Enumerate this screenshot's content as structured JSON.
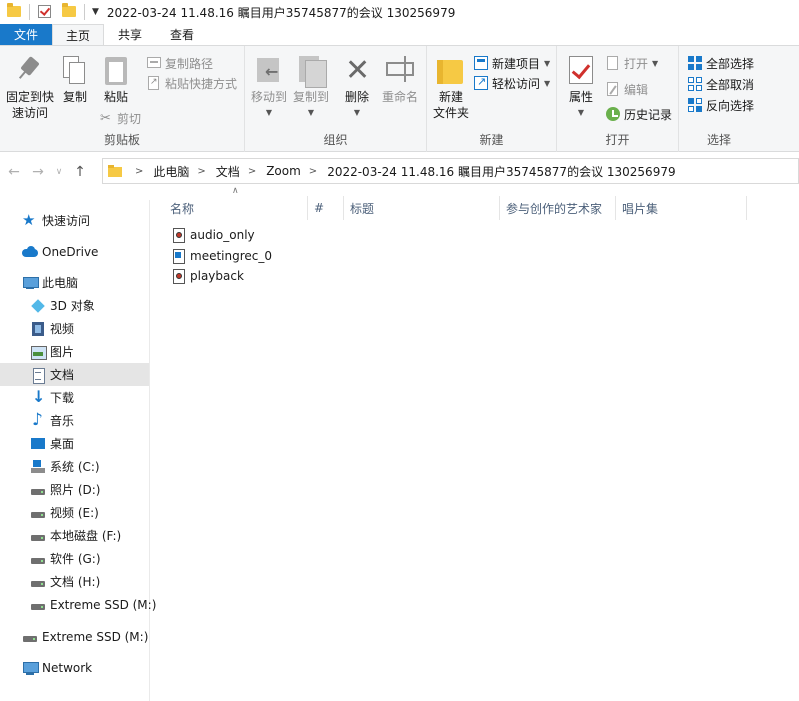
{
  "window": {
    "title": "2022-03-24 11.48.16 瞩目用户35745877的会议 130256979"
  },
  "tabs": [
    "文件",
    "主页",
    "共享",
    "查看"
  ],
  "ribbon": {
    "clipboard": {
      "pin_label": "固定到快\n速访问",
      "copy_label": "复制",
      "paste_label": "粘贴",
      "copy_path_label": "复制路径",
      "paste_shortcut_label": "粘贴快捷方式",
      "cut_label": "剪切",
      "group_label": "剪贴板"
    },
    "organize": {
      "move_to_label": "移动到",
      "copy_to_label": "复制到",
      "delete_label": "删除",
      "rename_label": "重命名",
      "group_label": "组织"
    },
    "new": {
      "new_folder_label": "新建\n文件夹",
      "new_item_label": "新建项目",
      "easy_access_label": "轻松访问",
      "group_label": "新建"
    },
    "open": {
      "properties_label": "属性",
      "open_label": "打开",
      "edit_label": "编辑",
      "history_label": "历史记录",
      "group_label": "打开"
    },
    "select": {
      "select_all_label": "全部选择",
      "select_none_label": "全部取消",
      "invert_label": "反向选择",
      "group_label": "选择"
    }
  },
  "address": {
    "crumbs": [
      "此电脑",
      "文档",
      "Zoom",
      "2022-03-24 11.48.16 瞩目用户35745877的会议 130256979"
    ]
  },
  "navpane": {
    "items": [
      {
        "label": "快速访问",
        "icon": "star-icon"
      },
      {
        "label": "OneDrive",
        "icon": "cloud-icon"
      },
      {
        "label": "此电脑",
        "icon": "computer-icon"
      },
      {
        "label": "3D 对象",
        "icon": "cube-icon"
      },
      {
        "label": "视频",
        "icon": "video-icon"
      },
      {
        "label": "图片",
        "icon": "pictures-icon"
      },
      {
        "label": "文档",
        "icon": "documents-icon"
      },
      {
        "label": "下载",
        "icon": "download-icon"
      },
      {
        "label": "音乐",
        "icon": "music-icon"
      },
      {
        "label": "桌面",
        "icon": "desktop-icon"
      },
      {
        "label": "系统 (C:)",
        "icon": "windows-drive-icon"
      },
      {
        "label": "照片 (D:)",
        "icon": "drive-icon"
      },
      {
        "label": "视频 (E:)",
        "icon": "drive-icon"
      },
      {
        "label": "本地磁盘 (F:)",
        "icon": "drive-icon"
      },
      {
        "label": "软件 (G:)",
        "icon": "drive-icon"
      },
      {
        "label": "文档 (H:)",
        "icon": "drive-icon"
      },
      {
        "label": "Extreme SSD (M:)",
        "icon": "drive-icon"
      },
      {
        "label": "Extreme SSD (M:)",
        "icon": "drive-icon"
      },
      {
        "label": "Network",
        "icon": "network-icon"
      }
    ]
  },
  "columns": [
    "名称",
    "#",
    "标题",
    "参与创作的艺术家",
    "唱片集"
  ],
  "files": [
    {
      "name": "audio_only",
      "icon": "media-file-icon"
    },
    {
      "name": "meetingrec_0",
      "icon": "meeting-file-icon"
    },
    {
      "name": "playback",
      "icon": "media-file-icon"
    }
  ]
}
